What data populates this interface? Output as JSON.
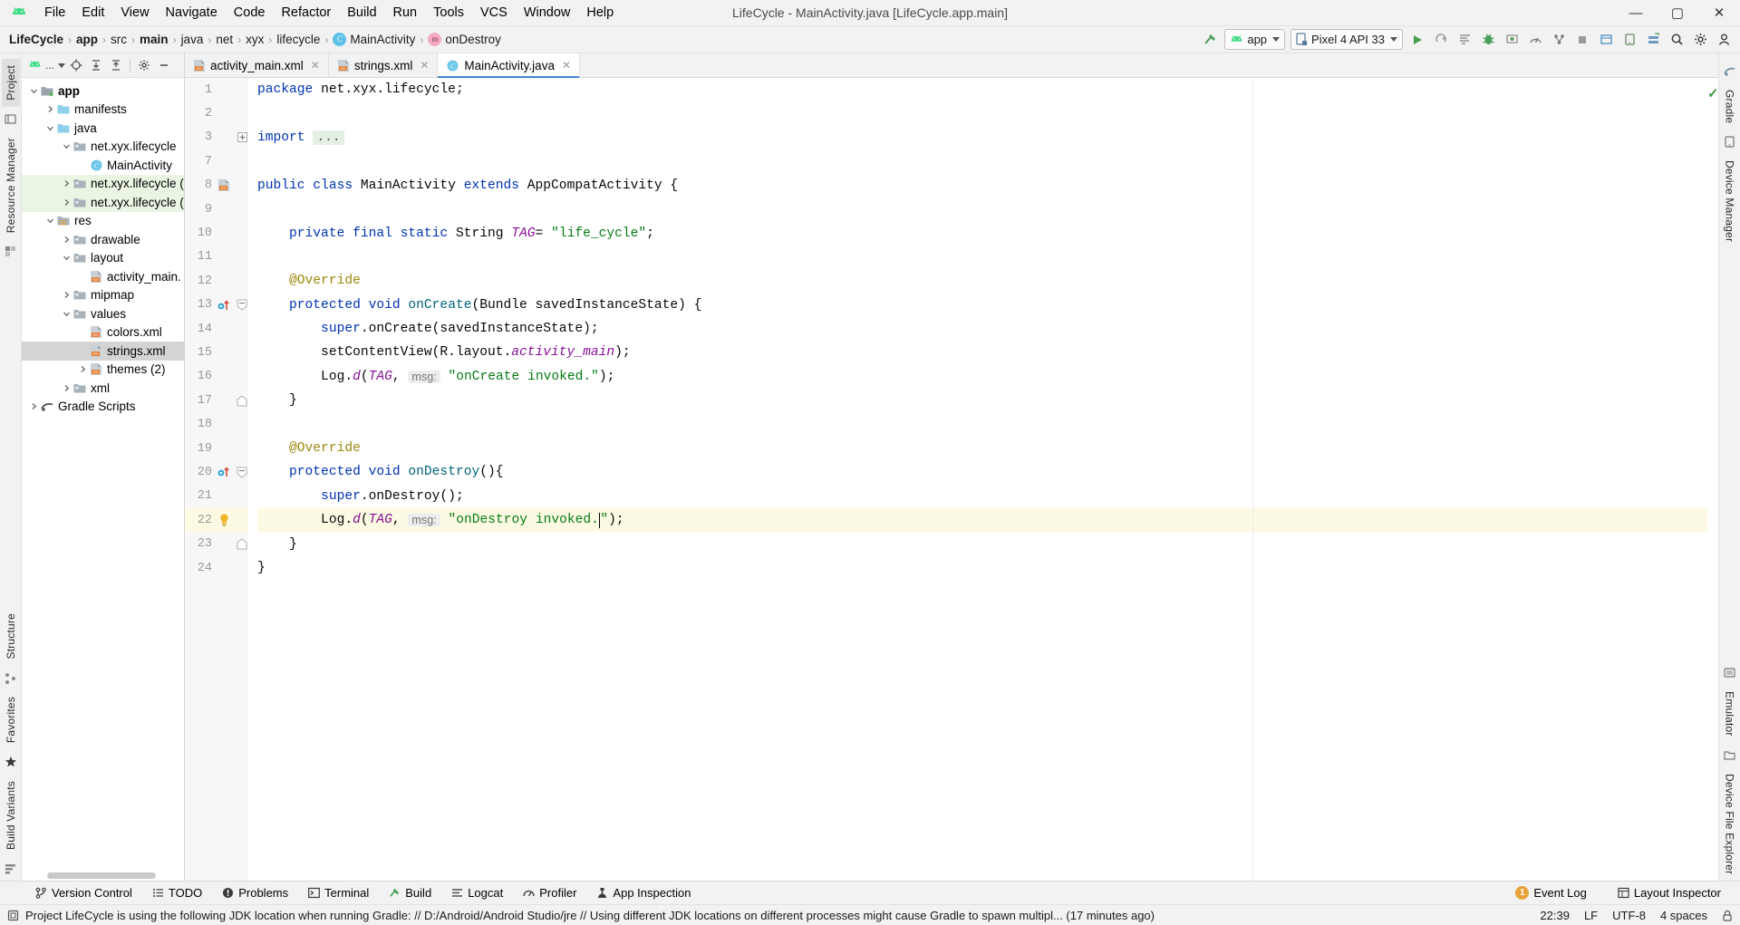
{
  "window": {
    "title": "LifeCycle - MainActivity.java [LifeCycle.app.main]",
    "minimize": "—",
    "maximize": "▢",
    "close": "✕"
  },
  "menu": {
    "items": [
      "File",
      "Edit",
      "View",
      "Navigate",
      "Code",
      "Refactor",
      "Build",
      "Run",
      "Tools",
      "VCS",
      "Window",
      "Help"
    ]
  },
  "breadcrumb": {
    "items": [
      {
        "label": "LifeCycle",
        "bold": true
      },
      {
        "label": "app",
        "bold": true
      },
      {
        "label": "src",
        "bold": false
      },
      {
        "label": "main",
        "bold": true
      },
      {
        "label": "java",
        "bold": false
      },
      {
        "label": "net",
        "bold": false
      },
      {
        "label": "xyx",
        "bold": false
      },
      {
        "label": "lifecycle",
        "bold": false
      },
      {
        "label": "MainActivity",
        "bold": false,
        "badge": "c"
      },
      {
        "label": "onDestroy",
        "bold": false,
        "badge": "m"
      }
    ],
    "separator": "›"
  },
  "toolbar": {
    "build_icon": "hammer-icon",
    "run_config": "app",
    "device": "Pixel 4 API 33",
    "actions": [
      "run-icon",
      "rerun-icon",
      "apply-changes-icon",
      "debug-icon",
      "attach-debugger-icon",
      "profiler-icon",
      "device-explorer-icon",
      "stop-icon",
      "layout-inspector-icon",
      "avd-manager-icon",
      "sdk-manager-icon",
      "search-icon",
      "settings-icon",
      "account-icon"
    ]
  },
  "left_rail": {
    "tabs": [
      {
        "label": "Project",
        "selected": true
      },
      {
        "label": "Resource Manager",
        "selected": false
      }
    ],
    "bottom_tabs": [
      {
        "label": "Structure",
        "selected": false
      },
      {
        "label": "Favorites",
        "selected": false
      },
      {
        "label": "Build Variants",
        "selected": false
      }
    ]
  },
  "right_rail": {
    "tabs": [
      {
        "label": "Gradle"
      },
      {
        "label": "Device Manager"
      },
      {
        "label": "Emulator"
      },
      {
        "label": "Device File Explorer"
      }
    ]
  },
  "project_panel": {
    "toolbar_title": "...",
    "toolbar_icons": [
      "android-view-icon",
      "locate-icon",
      "expand-all-icon",
      "collapse-all-icon",
      "settings-icon",
      "hide-icon"
    ],
    "tree": [
      {
        "label": "app",
        "depth": 0,
        "twist": "v",
        "icon": "module-icon",
        "bold": true,
        "state": "normal"
      },
      {
        "label": "manifests",
        "depth": 1,
        "twist": ">",
        "icon": "folder-blue-icon",
        "bold": false,
        "state": "normal"
      },
      {
        "label": "java",
        "depth": 1,
        "twist": "v",
        "icon": "folder-blue-icon",
        "bold": false,
        "state": "normal"
      },
      {
        "label": "net.xyx.lifecycle",
        "depth": 2,
        "twist": "v",
        "icon": "package-icon",
        "bold": false,
        "state": "normal"
      },
      {
        "label": "MainActivity",
        "depth": 3,
        "twist": "",
        "icon": "class-icon",
        "bold": false,
        "state": "normal"
      },
      {
        "label": "net.xyx.lifecycle (",
        "depth": 2,
        "twist": ">",
        "icon": "package-icon",
        "bold": false,
        "state": "green"
      },
      {
        "label": "net.xyx.lifecycle (",
        "depth": 2,
        "twist": ">",
        "icon": "package-icon",
        "bold": false,
        "state": "green"
      },
      {
        "label": "res",
        "depth": 1,
        "twist": "v",
        "icon": "res-folder-icon",
        "bold": false,
        "state": "normal"
      },
      {
        "label": "drawable",
        "depth": 2,
        "twist": ">",
        "icon": "folder-gray-icon",
        "bold": false,
        "state": "normal"
      },
      {
        "label": "layout",
        "depth": 2,
        "twist": "v",
        "icon": "folder-gray-icon",
        "bold": false,
        "state": "normal"
      },
      {
        "label": "activity_main.",
        "depth": 3,
        "twist": "",
        "icon": "xml-file-icon",
        "bold": false,
        "state": "normal"
      },
      {
        "label": "mipmap",
        "depth": 2,
        "twist": ">",
        "icon": "folder-gray-icon",
        "bold": false,
        "state": "normal"
      },
      {
        "label": "values",
        "depth": 2,
        "twist": "v",
        "icon": "folder-gray-icon",
        "bold": false,
        "state": "normal"
      },
      {
        "label": "colors.xml",
        "depth": 3,
        "twist": "",
        "icon": "xml-file-icon",
        "bold": false,
        "state": "normal"
      },
      {
        "label": "strings.xml",
        "depth": 3,
        "twist": "",
        "icon": "xml-file-icon",
        "bold": false,
        "state": "selected"
      },
      {
        "label": "themes (2)",
        "depth": 3,
        "twist": ">",
        "icon": "xml-file-icon",
        "bold": false,
        "state": "normal"
      },
      {
        "label": "xml",
        "depth": 2,
        "twist": ">",
        "icon": "folder-gray-icon",
        "bold": false,
        "state": "normal"
      },
      {
        "label": "Gradle Scripts",
        "depth": 0,
        "twist": ">",
        "icon": "gradle-icon",
        "bold": false,
        "state": "normal"
      }
    ]
  },
  "editor": {
    "tabs": [
      {
        "label": "activity_main.xml",
        "icon": "xml-file-icon",
        "active": false
      },
      {
        "label": "strings.xml",
        "icon": "xml-file-icon",
        "active": false
      },
      {
        "label": "MainActivity.java",
        "icon": "class-icon",
        "active": true
      }
    ],
    "inspection_ok": "✓",
    "lines": [
      {
        "num": "1",
        "marker": "",
        "fold": "",
        "highlight": false,
        "tokens": [
          {
            "t": "package ",
            "c": "kw"
          },
          {
            "t": "net.xyx.lifecycle;",
            "c": "plain"
          }
        ]
      },
      {
        "num": "2",
        "marker": "",
        "fold": "",
        "highlight": false,
        "tokens": []
      },
      {
        "num": "3",
        "marker": "",
        "fold": "+",
        "highlight": false,
        "tokens": [
          {
            "t": "import ",
            "c": "kw"
          },
          {
            "t": "...",
            "c": "fold-ph"
          }
        ]
      },
      {
        "num": "7",
        "marker": "",
        "fold": "",
        "highlight": false,
        "tokens": []
      },
      {
        "num": "8",
        "marker": "xml-file-icon",
        "fold": "",
        "highlight": false,
        "tokens": [
          {
            "t": "public class ",
            "c": "kw"
          },
          {
            "t": "MainActivity",
            "c": "plain"
          },
          {
            "t": " extends ",
            "c": "kw"
          },
          {
            "t": "AppCompatActivity {",
            "c": "plain"
          }
        ]
      },
      {
        "num": "9",
        "marker": "",
        "fold": "",
        "highlight": false,
        "tokens": []
      },
      {
        "num": "10",
        "marker": "",
        "fold": "",
        "highlight": false,
        "tokens": [
          {
            "t": "    private final static ",
            "c": "kw"
          },
          {
            "t": "String ",
            "c": "plain"
          },
          {
            "t": "TAG",
            "c": "fld"
          },
          {
            "t": "= ",
            "c": "plain"
          },
          {
            "t": "\"life_cycle\"",
            "c": "str"
          },
          {
            "t": ";",
            "c": "plain"
          }
        ]
      },
      {
        "num": "11",
        "marker": "",
        "fold": "",
        "highlight": false,
        "tokens": []
      },
      {
        "num": "12",
        "marker": "",
        "fold": "",
        "highlight": false,
        "tokens": [
          {
            "t": "    @Override",
            "c": "anno"
          }
        ]
      },
      {
        "num": "13",
        "marker": "override-icon",
        "fold": "-",
        "highlight": false,
        "tokens": [
          {
            "t": "    protected void ",
            "c": "kw"
          },
          {
            "t": "onCreate",
            "c": "fn"
          },
          {
            "t": "(Bundle savedInstanceState) {",
            "c": "plain"
          }
        ]
      },
      {
        "num": "14",
        "marker": "",
        "fold": "",
        "highlight": false,
        "tokens": [
          {
            "t": "        super",
            "c": "kw"
          },
          {
            "t": ".onCreate(savedInstanceState);",
            "c": "plain"
          }
        ]
      },
      {
        "num": "15",
        "marker": "",
        "fold": "",
        "highlight": false,
        "tokens": [
          {
            "t": "        setContentView(R.layout.",
            "c": "plain"
          },
          {
            "t": "activity_main",
            "c": "fld"
          },
          {
            "t": ");",
            "c": "plain"
          }
        ]
      },
      {
        "num": "16",
        "marker": "",
        "fold": "",
        "highlight": false,
        "tokens": [
          {
            "t": "        Log.",
            "c": "plain"
          },
          {
            "t": "d",
            "c": "fld"
          },
          {
            "t": "(",
            "c": "plain"
          },
          {
            "t": "TAG",
            "c": "fld"
          },
          {
            "t": ", ",
            "c": "plain"
          },
          {
            "t": "msg:",
            "c": "hint"
          },
          {
            "t": " ",
            "c": "plain"
          },
          {
            "t": "\"onCreate invoked.\"",
            "c": "str"
          },
          {
            "t": ");",
            "c": "plain"
          }
        ]
      },
      {
        "num": "17",
        "marker": "",
        "fold": "^",
        "highlight": false,
        "tokens": [
          {
            "t": "    }",
            "c": "plain"
          }
        ]
      },
      {
        "num": "18",
        "marker": "",
        "fold": "",
        "highlight": false,
        "tokens": []
      },
      {
        "num": "19",
        "marker": "",
        "fold": "",
        "highlight": false,
        "tokens": [
          {
            "t": "    @Override",
            "c": "anno"
          }
        ]
      },
      {
        "num": "20",
        "marker": "override-icon",
        "fold": "-",
        "highlight": false,
        "tokens": [
          {
            "t": "    protected void ",
            "c": "kw"
          },
          {
            "t": "onDestroy",
            "c": "fn"
          },
          {
            "t": "(){",
            "c": "plain"
          }
        ]
      },
      {
        "num": "21",
        "marker": "",
        "fold": "",
        "highlight": false,
        "tokens": [
          {
            "t": "        super",
            "c": "kw"
          },
          {
            "t": ".onDestroy();",
            "c": "plain"
          }
        ]
      },
      {
        "num": "22",
        "marker": "lightbulb-icon",
        "fold": "",
        "highlight": true,
        "tokens": [
          {
            "t": "        Log.",
            "c": "plain"
          },
          {
            "t": "d",
            "c": "fld"
          },
          {
            "t": "(",
            "c": "plain"
          },
          {
            "t": "TAG",
            "c": "fld"
          },
          {
            "t": ", ",
            "c": "plain"
          },
          {
            "t": "msg:",
            "c": "hint"
          },
          {
            "t": " ",
            "c": "plain"
          },
          {
            "t": "\"onDestroy invoked.",
            "c": "str"
          },
          {
            "t": "CARET",
            "c": "caret"
          },
          {
            "t": "\"",
            "c": "str"
          },
          {
            "t": ");",
            "c": "plain"
          }
        ]
      },
      {
        "num": "23",
        "marker": "",
        "fold": "^",
        "highlight": false,
        "tokens": [
          {
            "t": "    }",
            "c": "plain"
          }
        ]
      },
      {
        "num": "24",
        "marker": "",
        "fold": "",
        "highlight": false,
        "tokens": [
          {
            "t": "}",
            "c": "plain"
          }
        ]
      }
    ]
  },
  "bottom_tools": [
    {
      "label": "Version Control",
      "icon": "branch-icon"
    },
    {
      "label": "TODO",
      "icon": "todo-icon"
    },
    {
      "label": "Problems",
      "icon": "problems-icon"
    },
    {
      "label": "Terminal",
      "icon": "terminal-icon"
    },
    {
      "label": "Build",
      "icon": "hammer-icon"
    },
    {
      "label": "Logcat",
      "icon": "logcat-icon"
    },
    {
      "label": "Profiler",
      "icon": "profiler-icon"
    },
    {
      "label": "App Inspection",
      "icon": "app-inspection-icon"
    }
  ],
  "bottom_right": {
    "event_log_count": "1",
    "event_log": "Event Log",
    "layout_inspector": "Layout Inspector",
    "layout_inspector_icon": "layout-inspector-icon"
  },
  "status_bar": {
    "icon": "notification-icon",
    "message": "Project LifeCycle is using the following JDK location when running Gradle: // D:/Android/Android Studio/jre // Using different JDK locations on different processes might cause Gradle to spawn multipl... (17 minutes ago)",
    "time": "22:39",
    "line_sep": "LF",
    "encoding": "UTF-8",
    "indent": "4 spaces",
    "lock_icon": "lock-icon"
  },
  "colors": {
    "accent_blue": "#4385c6",
    "keyword": "#0033b3",
    "string": "#067d17",
    "field": "#871094",
    "annotation": "#9e880d",
    "method": "#00627a",
    "green_row": "#eaf5e4",
    "current_line": "#fcfae2",
    "android_green": "#3ddc84"
  }
}
